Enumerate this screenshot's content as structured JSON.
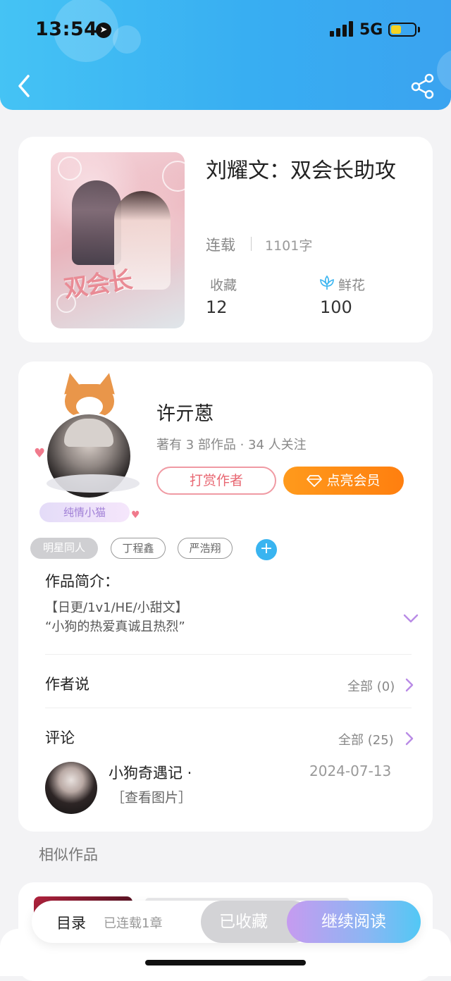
{
  "status_bar": {
    "time": "13:54",
    "network": "5G"
  },
  "book": {
    "title": "刘耀文：双会长助攻",
    "status": "连载",
    "word_count": "1101字",
    "favorites_label": "收藏",
    "favorites_value": "12",
    "flowers_label": "鲜花",
    "flowers_value": "100"
  },
  "author": {
    "name": "许亓蒽",
    "meta": "著有 3 部作品 · 34 人关注",
    "avatar_tag": "纯情小猫",
    "reward_label": "打赏作者",
    "vip_label": "点亮会员"
  },
  "tags": [
    "明星同人",
    "丁程鑫",
    "严浩翔"
  ],
  "intro": {
    "title": "作品简介：",
    "line1": "【日更/1v1/HE/小甜文】",
    "line2": "“小狗的热爱真诚且热烈”"
  },
  "author_says": {
    "title": "作者说",
    "all_label": "全部 (0)"
  },
  "comments": {
    "title": "评论",
    "all_label": "全部 (25)",
    "items": [
      {
        "user": "小狗奇遇记 ·",
        "date": "2024-07-13",
        "text": "［查看图片］"
      }
    ]
  },
  "similar_title": "相似作品",
  "bottom_bar": {
    "toc_label": "目录",
    "toc_status": "已连载1章",
    "collected_label": "已收藏",
    "continue_label": "继续阅读"
  }
}
